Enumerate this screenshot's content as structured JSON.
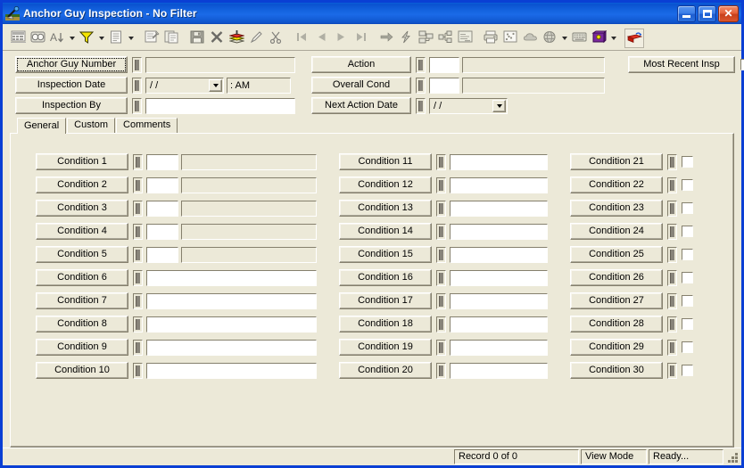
{
  "window": {
    "title": "Anchor Guy Inspection - No Filter",
    "icon": "anchor-guy-icon",
    "minimize_label": "Minimize",
    "maximize_label": "Maximize",
    "close_label": "Close"
  },
  "toolbar": {
    "items": [
      {
        "name": "select-records-icon",
        "glyph": "grid"
      },
      {
        "name": "find-record-icon",
        "glyph": "binoculars"
      },
      {
        "name": "sort-icon",
        "glyph": "sort",
        "dropdown": true
      },
      {
        "name": "filter-icon",
        "glyph": "funnel",
        "dropdown": true,
        "color": true
      },
      {
        "name": "report-icon",
        "glyph": "document",
        "dropdown": true
      },
      {
        "name": "properties-icon",
        "glyph": "properties"
      },
      {
        "name": "copy-record-icon",
        "glyph": "copy"
      },
      {
        "name": "save-icon",
        "glyph": "save"
      },
      {
        "name": "delete-icon",
        "glyph": "x-mark"
      },
      {
        "name": "layers-icon",
        "glyph": "layers",
        "color": true
      },
      {
        "name": "edit-icon",
        "glyph": "pencil"
      },
      {
        "name": "cut-icon",
        "glyph": "scissors"
      },
      {
        "name": "first-record-icon",
        "glyph": "nav-first"
      },
      {
        "name": "previous-record-icon",
        "glyph": "nav-prev"
      },
      {
        "name": "next-record-icon",
        "glyph": "nav-next"
      },
      {
        "name": "last-record-icon",
        "glyph": "nav-last"
      },
      {
        "name": "goto-record-icon",
        "glyph": "arrow-right"
      },
      {
        "name": "lightning-icon",
        "glyph": "lightning"
      },
      {
        "name": "related-records-icon",
        "glyph": "related"
      },
      {
        "name": "hierarchy-icon",
        "glyph": "hierarchy"
      },
      {
        "name": "notes-icon",
        "glyph": "notes"
      },
      {
        "name": "print-icon",
        "glyph": "printer"
      },
      {
        "name": "chart-icon",
        "glyph": "scatter"
      },
      {
        "name": "map-icon",
        "glyph": "cloud"
      },
      {
        "name": "globe-icon",
        "glyph": "globe",
        "dropdown": true
      },
      {
        "name": "keyboard-icon",
        "glyph": "keyboard"
      },
      {
        "name": "book-icon",
        "glyph": "book",
        "color": true,
        "dropdown": true
      },
      {
        "name": "exit-icon",
        "glyph": "exit",
        "color": true,
        "framed": true
      }
    ]
  },
  "header": {
    "left": [
      {
        "name": "anchor-guy-number",
        "label": "Anchor Guy Number",
        "value": "",
        "focused": true,
        "type": "text-dim"
      },
      {
        "name": "inspection-date",
        "label": "Inspection Date",
        "value": "/  /",
        "time_value": ":    AM",
        "type": "date-time"
      },
      {
        "name": "inspection-by",
        "label": "Inspection By",
        "value": "",
        "type": "text"
      }
    ],
    "middle": [
      {
        "name": "action",
        "label": "Action",
        "code": "",
        "value": "",
        "type": "code-desc"
      },
      {
        "name": "overall-cond",
        "label": "Overall Cond",
        "code": "",
        "value": "",
        "type": "code-desc"
      },
      {
        "name": "next-action-date",
        "label": "Next Action Date",
        "value": "/  /",
        "type": "date"
      }
    ],
    "right": {
      "name": "most-recent-insp",
      "label": "Most Recent Insp",
      "checked": false
    }
  },
  "tabs": [
    {
      "name": "tab-general",
      "label": "General",
      "active": true
    },
    {
      "name": "tab-custom",
      "label": "Custom",
      "active": false
    },
    {
      "name": "tab-comments",
      "label": "Comments",
      "active": false
    }
  ],
  "conditions": {
    "column1": [
      {
        "label": "Condition 1",
        "code": "",
        "value": "",
        "type": "code-desc"
      },
      {
        "label": "Condition 2",
        "code": "",
        "value": "",
        "type": "code-desc"
      },
      {
        "label": "Condition 3",
        "code": "",
        "value": "",
        "type": "code-desc"
      },
      {
        "label": "Condition 4",
        "code": "",
        "value": "",
        "type": "code-desc"
      },
      {
        "label": "Condition 5",
        "code": "",
        "value": "",
        "type": "code-desc"
      },
      {
        "label": "Condition 6",
        "value": "",
        "type": "text"
      },
      {
        "label": "Condition 7",
        "value": "",
        "type": "text"
      },
      {
        "label": "Condition 8",
        "value": "",
        "type": "text"
      },
      {
        "label": "Condition 9",
        "value": "",
        "type": "text"
      },
      {
        "label": "Condition 10",
        "value": "",
        "type": "text"
      }
    ],
    "column2": [
      {
        "label": "Condition 11",
        "value": "",
        "type": "text"
      },
      {
        "label": "Condition 12",
        "value": "",
        "type": "text"
      },
      {
        "label": "Condition 13",
        "value": "",
        "type": "text"
      },
      {
        "label": "Condition 14",
        "value": "",
        "type": "text"
      },
      {
        "label": "Condition 15",
        "value": "",
        "type": "text"
      },
      {
        "label": "Condition 16",
        "value": "",
        "type": "text"
      },
      {
        "label": "Condition 17",
        "value": "",
        "type": "text"
      },
      {
        "label": "Condition 18",
        "value": "",
        "type": "text"
      },
      {
        "label": "Condition 19",
        "value": "",
        "type": "text"
      },
      {
        "label": "Condition 20",
        "value": "",
        "type": "text"
      }
    ],
    "column3": [
      {
        "label": "Condition 21",
        "checked": false,
        "type": "checkbox"
      },
      {
        "label": "Condition 22",
        "checked": false,
        "type": "checkbox"
      },
      {
        "label": "Condition 23",
        "checked": false,
        "type": "checkbox"
      },
      {
        "label": "Condition 24",
        "checked": false,
        "type": "checkbox"
      },
      {
        "label": "Condition 25",
        "checked": false,
        "type": "checkbox"
      },
      {
        "label": "Condition 26",
        "checked": false,
        "type": "checkbox"
      },
      {
        "label": "Condition 27",
        "checked": false,
        "type": "checkbox"
      },
      {
        "label": "Condition 28",
        "checked": false,
        "type": "checkbox"
      },
      {
        "label": "Condition 29",
        "checked": false,
        "type": "checkbox"
      },
      {
        "label": "Condition 30",
        "checked": false,
        "type": "checkbox"
      }
    ]
  },
  "status": {
    "record": "Record 0 of 0",
    "mode": "View Mode",
    "state": "Ready..."
  },
  "colors": {
    "titlebar_blue": "#1565e0",
    "window_border": "#0a3fd4",
    "face": "#ece9d8",
    "shadow": "#85806d",
    "close_red": "#c8401c"
  }
}
